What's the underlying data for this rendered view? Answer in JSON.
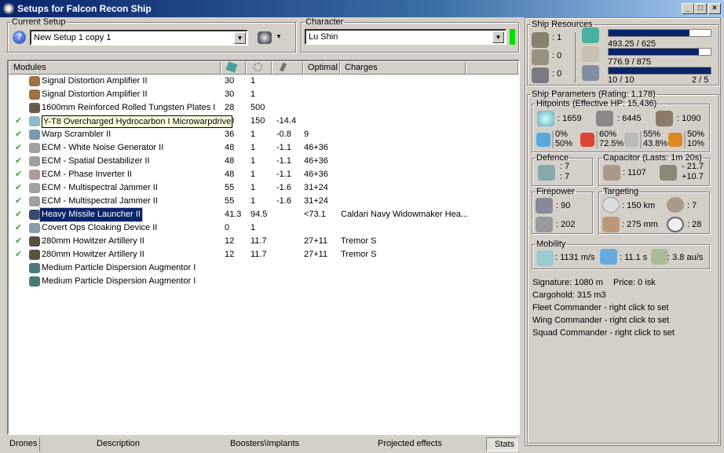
{
  "window": {
    "title": "Setups for Falcon Recon Ship",
    "buttons": [
      "_",
      "□",
      "×"
    ]
  },
  "setup": {
    "label": "Current Setup",
    "value": "New Setup 1 copy 1"
  },
  "character": {
    "label": "Character",
    "value": "Lu Shin",
    "status_color": "#00e000"
  },
  "modules": {
    "headers": [
      "Modules",
      "",
      "",
      "",
      "Optimal",
      "Charges"
    ],
    "header_icons": [
      "cpu-icon",
      "powergrid-icon",
      "capacitor-icon"
    ],
    "rows": [
      {
        "name": "Signal Distortion Amplifier II",
        "active": false,
        "cpu": "30",
        "pg": "1",
        "cap": "",
        "optimal": "",
        "charges": "",
        "icon_color": "#a07040"
      },
      {
        "name": "Signal Distortion Amplifier II",
        "active": false,
        "cpu": "30",
        "pg": "1",
        "cap": "",
        "optimal": "",
        "charges": "",
        "icon_color": "#a07040"
      },
      {
        "name": "1600mm Reinforced Rolled Tungsten Plates I",
        "active": false,
        "cpu": "28",
        "pg": "500",
        "cap": "",
        "optimal": "",
        "charges": "",
        "icon_color": "#6a5a4a"
      },
      {
        "name": "Y-T8 Overcharged Hydrocarbon I Microwarpdrive",
        "active": true,
        "cpu": "50",
        "pg": "150",
        "cap": "-14.4",
        "optimal": "",
        "charges": "",
        "icon_color": "#8fb8c8",
        "tooltip": true
      },
      {
        "name": "Warp Scrambler II",
        "active": true,
        "cpu": "36",
        "pg": "1",
        "cap": "-0.8",
        "optimal": "9",
        "charges": "",
        "icon_color": "#7a9ab0"
      },
      {
        "name": "ECM - White Noise Generator II",
        "active": true,
        "cpu": "48",
        "pg": "1",
        "cap": "-1.1",
        "optimal": "46+36",
        "charges": "",
        "icon_color": "#a0a0a0"
      },
      {
        "name": "ECM - Spatial Destabilizer II",
        "active": true,
        "cpu": "48",
        "pg": "1",
        "cap": "-1.1",
        "optimal": "46+36",
        "charges": "",
        "icon_color": "#a0a0a0"
      },
      {
        "name": "ECM - Phase Inverter II",
        "active": true,
        "cpu": "48",
        "pg": "1",
        "cap": "-1.1",
        "optimal": "46+36",
        "charges": "",
        "icon_color": "#b09a9a"
      },
      {
        "name": "ECM - Multispectral Jammer II",
        "active": true,
        "cpu": "55",
        "pg": "1",
        "cap": "-1.6",
        "optimal": "31+24",
        "charges": "",
        "icon_color": "#a0a0a0"
      },
      {
        "name": "ECM - Multispectral Jammer II",
        "active": true,
        "cpu": "55",
        "pg": "1",
        "cap": "-1.6",
        "optimal": "31+24",
        "charges": "",
        "icon_color": "#a0a0a0"
      },
      {
        "name": "Heavy Missile Launcher II",
        "active": true,
        "cpu": "41.3",
        "pg": "94.5",
        "cap": "",
        "optimal": "<73.1",
        "charges": "Caldari Navy Widowmaker Hea...",
        "icon_color": "#3a4a6a",
        "selected": true
      },
      {
        "name": "Covert Ops Cloaking Device II",
        "active": true,
        "cpu": "0",
        "pg": "1",
        "cap": "",
        "optimal": "",
        "charges": "",
        "icon_color": "#8a9aaa"
      },
      {
        "name": "280mm Howitzer Artillery II",
        "active": true,
        "cpu": "12",
        "pg": "11.7",
        "cap": "",
        "optimal": "27+11",
        "charges": "Tremor S",
        "icon_color": "#5a5040"
      },
      {
        "name": "280mm Howitzer Artillery II",
        "active": true,
        "cpu": "12",
        "pg": "11.7",
        "cap": "",
        "optimal": "27+11",
        "charges": "Tremor S",
        "icon_color": "#5a5040"
      },
      {
        "name": "Medium Particle Dispersion Augmentor I",
        "active": false,
        "cpu": "",
        "pg": "",
        "cap": "",
        "optimal": "",
        "charges": "",
        "icon_color": "#4a7a7a"
      },
      {
        "name": "Medium Particle Dispersion Augmentor I",
        "active": false,
        "cpu": "",
        "pg": "",
        "cap": "",
        "optimal": "",
        "charges": "",
        "icon_color": "#4a7a7a"
      }
    ]
  },
  "tabs": [
    "Drones",
    "Description",
    "Boosters\\Implants",
    "Projected effects",
    "Stats"
  ],
  "resources": {
    "label": "Ship Resources",
    "turrets": ": 1",
    "launchers": ": 0",
    "rigs": ": 0",
    "cpu": {
      "text": "493.25 / 625",
      "fraction": 0.789
    },
    "powergrid": {
      "text": "776.9 / 875",
      "fraction": 0.888
    },
    "calibration": {
      "text": "10 / 10",
      "fraction": 1.0
    },
    "drones": "2 / 5",
    "bar_color": "#0a246a"
  },
  "params": {
    "label": "Ship Parameters (Rating: 1,178)",
    "hitpoints": {
      "label": "Hitpoints (Effective HP: 15,436)",
      "shield": ": 1659",
      "armor": ": 6445",
      "structure": ": 1090",
      "resists": [
        {
          "icon": "em-icon",
          "a": "0%",
          "b": "50%"
        },
        {
          "icon": "thermal-icon",
          "a": "60%",
          "b": "72.5%"
        },
        {
          "icon": "kinetic-icon",
          "a": "55%",
          "b": "43.8%"
        },
        {
          "icon": "explosive-icon",
          "a": "50%",
          "b": "10%"
        }
      ]
    },
    "defence": {
      "label": "Defence",
      "a": ": 7",
      "b": ": 7"
    },
    "capacitor": {
      "label": "Capacitor (Lasts: 1m 20s)",
      "capacity": ": 1107",
      "use": "- 21.7",
      "recharge": "+10.7"
    },
    "firepower": {
      "label": "Firepower",
      "volley": ": 90",
      "dps": ": 202"
    },
    "targeting": {
      "label": "Targeting",
      "range": ": 150 km",
      "targets": ": 7",
      "resolution": ": 275 mm",
      "sensor": ": 28"
    },
    "mobility": {
      "label": "Mobility",
      "speed": ": 1131 m/s",
      "align": ": 11.1 s",
      "warp": ": 3.8 au/s"
    },
    "signature": "Signature: 1080 m",
    "price": "Price: 0 isk",
    "cargo": "Cargohold: 315 m3",
    "fleet": "Fleet Commander - right click to set",
    "wing": "Wing Commander - right click to set",
    "squad": "Squad Commander - right click to set"
  }
}
